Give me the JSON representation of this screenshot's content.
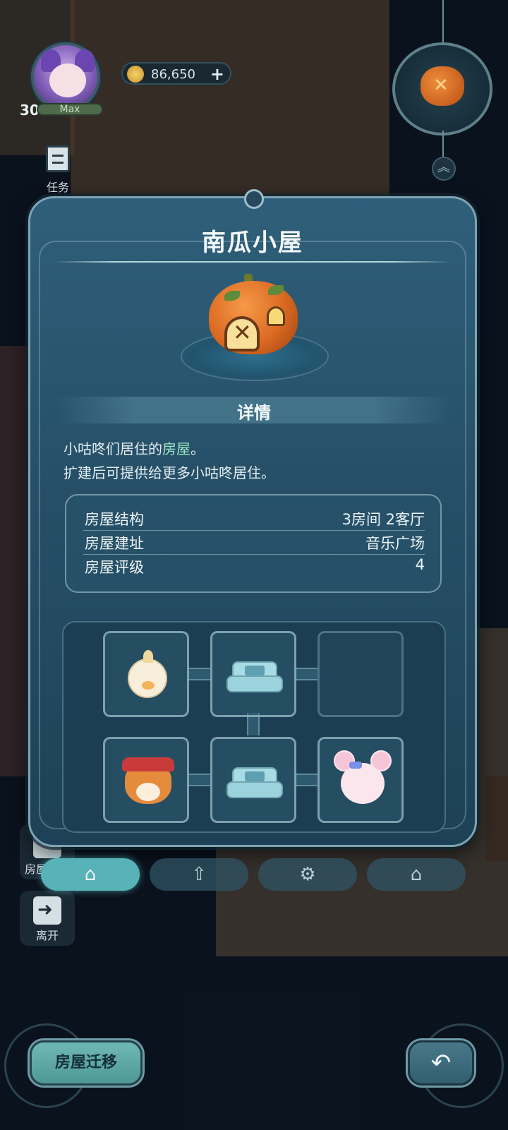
{
  "hud": {
    "level": "30",
    "level_status": "Max",
    "coins": "86,650",
    "coin_add": "+",
    "quest_label": "任务",
    "chevron": "︽"
  },
  "side_buttons": {
    "expand_label": "房屋扩建",
    "leave_label": "离开"
  },
  "modal": {
    "title": "南瓜小屋",
    "section_title": "详情",
    "description_line1_prefix": "小咕咚们居住的",
    "description_line1_highlight": "房屋",
    "description_line1_suffix": "。",
    "description_line2": "扩建后可提供给更多小咕咚居住。",
    "highlight_color": "#9ee7c5",
    "info": [
      {
        "label": "房屋结构",
        "value": "3房间 2客厅"
      },
      {
        "label": "房屋建址",
        "value": "音乐广场"
      },
      {
        "label": "房屋评级",
        "value": "4"
      }
    ],
    "rooms": [
      {
        "type": "resident",
        "icon": "chick-character-icon"
      },
      {
        "type": "living-room",
        "icon": "sofa-icon"
      },
      {
        "type": "empty",
        "icon": ""
      },
      {
        "type": "resident",
        "icon": "fox-character-icon"
      },
      {
        "type": "living-room",
        "icon": "sofa-icon"
      },
      {
        "type": "resident",
        "icon": "mouse-character-icon"
      }
    ],
    "tabs": [
      {
        "name": "house-info",
        "icon": "house-icon",
        "active": true
      },
      {
        "name": "upgrade",
        "icon": "upgrade-arrow-icon",
        "active": false
      },
      {
        "name": "residents",
        "icon": "cat-settings-icon",
        "active": false
      },
      {
        "name": "house-settings",
        "icon": "house-wrench-icon",
        "active": false
      }
    ]
  },
  "bottom": {
    "move_label": "房屋迁移",
    "back_icon": "undo-arrow-icon"
  }
}
